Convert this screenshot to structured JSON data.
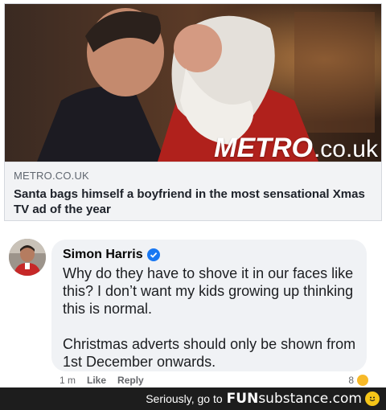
{
  "link_preview": {
    "image_alt": "Two men kissing, one dressed as Santa Claus",
    "logo_main": "METRO",
    "logo_domain": ".co.uk",
    "domain": "METRO.CO.UK",
    "headline": "Santa bags himself a boyfriend in the most sensational Xmas TV ad of the year"
  },
  "comment": {
    "author": "Simon Harris",
    "verified": true,
    "paragraphs": [
      "Why do they have to shove it in our faces like this? I don’t want my kids growing up thinking this is normal.",
      "Christmas adverts should only be shown from 1st December onwards."
    ],
    "actions": {
      "time": "1 m",
      "like": "Like",
      "reply": "Reply"
    },
    "reaction_count": "8"
  },
  "watermark": {
    "text": "Seriously, go to",
    "brand_fun": "FUN",
    "brand_sub": "substance",
    "brand_tld": ".com"
  },
  "colors": {
    "verified": "#1877f2",
    "bubble": "#f0f2f5",
    "link_meta_bg": "#f2f3f5",
    "watermark_bar": "#1d1d1d"
  }
}
